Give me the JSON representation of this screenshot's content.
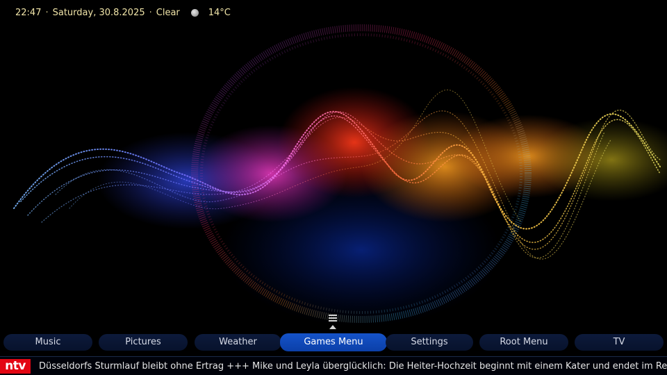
{
  "status": {
    "time": "22:47",
    "date": "Saturday, 30.8.2025",
    "condition": "Clear",
    "temperature": "14°C",
    "weather_icon": "moon-icon"
  },
  "main_menu": {
    "items": [
      {
        "label": "Music"
      },
      {
        "label": "Pictures"
      },
      {
        "label": "Weather"
      },
      {
        "label": "Games Menu",
        "active": true
      },
      {
        "label": "Settings"
      },
      {
        "label": "Root Menu"
      },
      {
        "label": "TV"
      }
    ],
    "handle_icon": "menu-handle-icon"
  },
  "ticker": {
    "logo_text": "ntv",
    "logo_color": "#e30613",
    "text": "Düsseldorfs Sturmlauf bleibt ohne Ertrag +++ Mike und Leyla überglücklich: Die Heiter-Hochzeit beginnt mit einem Kater und endet im Re"
  },
  "colors": {
    "accent": "#0b3fa8",
    "menu_bg": "#07122c",
    "status_text": "#f0e4a8"
  }
}
